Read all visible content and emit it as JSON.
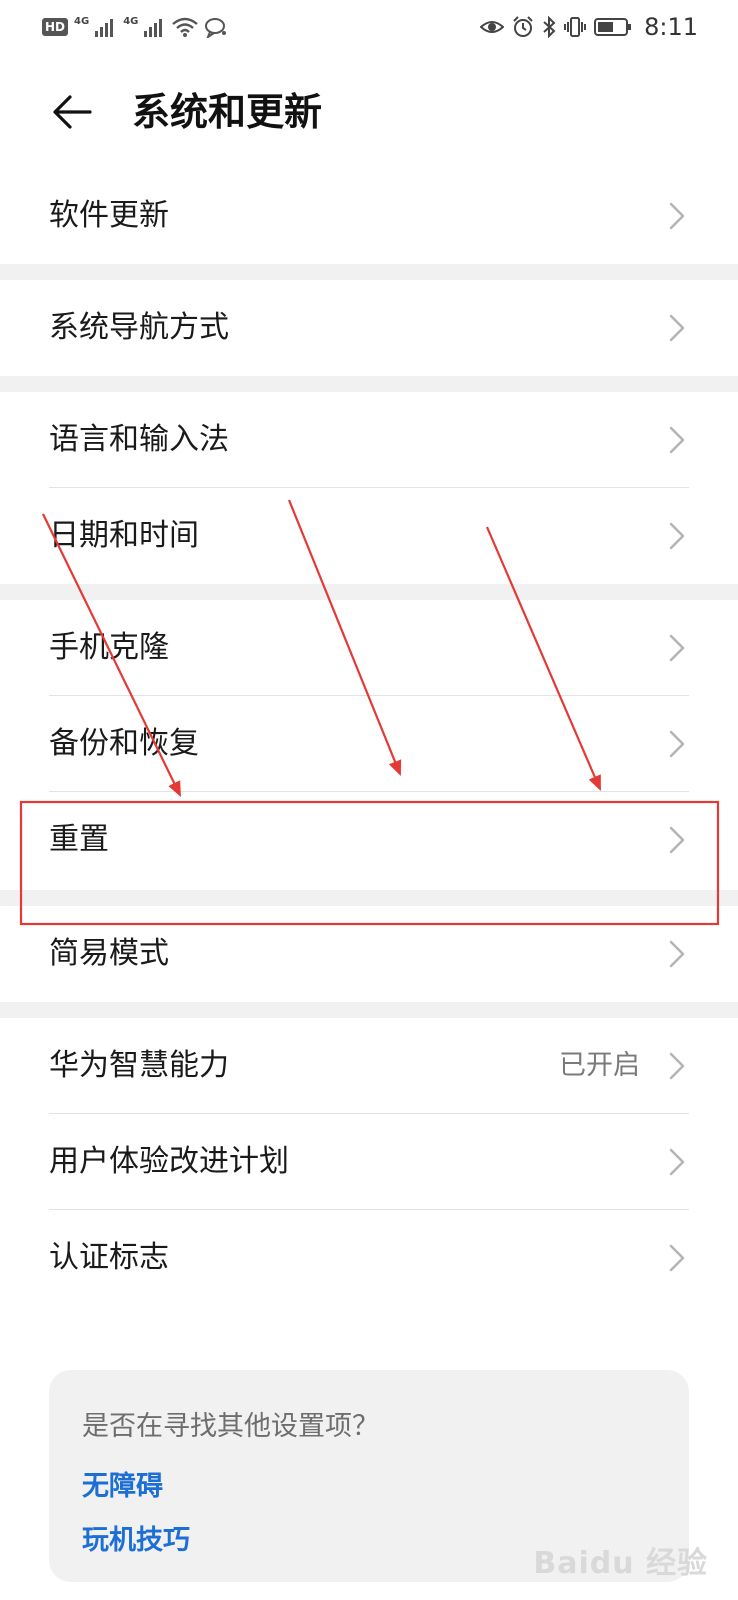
{
  "status_bar": {
    "hd_badge": "HD",
    "sim_1_network": "4G",
    "sim_2_network": "4G",
    "time": "8:11",
    "icons_left": [
      "hd-icon",
      "signal-icon",
      "signal-icon",
      "wifi-icon",
      "chat-icon"
    ],
    "icons_right": [
      "eye-comfort-icon",
      "alarm-icon",
      "bluetooth-icon",
      "vibrate-icon",
      "battery-icon"
    ]
  },
  "header": {
    "title": "系统和更新",
    "back_icon": "back-arrow-icon"
  },
  "groups": [
    {
      "items": [
        {
          "label": "软件更新",
          "value": ""
        }
      ]
    },
    {
      "items": [
        {
          "label": "系统导航方式",
          "value": ""
        }
      ]
    },
    {
      "items": [
        {
          "label": "语言和输入法",
          "value": ""
        },
        {
          "label": "日期和时间",
          "value": ""
        }
      ]
    },
    {
      "items": [
        {
          "label": "手机克隆",
          "value": ""
        },
        {
          "label": "备份和恢复",
          "value": ""
        },
        {
          "label": "重置",
          "value": ""
        }
      ]
    },
    {
      "items": [
        {
          "label": "简易模式",
          "value": ""
        }
      ]
    },
    {
      "items": [
        {
          "label": "华为智慧能力",
          "value": "已开启"
        },
        {
          "label": "用户体验改进计划",
          "value": ""
        },
        {
          "label": "认证标志",
          "value": ""
        }
      ]
    }
  ],
  "suggestions": {
    "title": "是否在寻找其他设置项？",
    "links": [
      "无障碍",
      "玩机技巧"
    ]
  },
  "annotation": {
    "highlight_color": "#e53935",
    "arrow_color": "#e53935",
    "highlighted_item": "重置"
  },
  "watermark": "Baidu 经验",
  "colors": {
    "link": "#1d6fd6",
    "gap": "#f1f1f1",
    "chevron": "#b5b5b5"
  }
}
